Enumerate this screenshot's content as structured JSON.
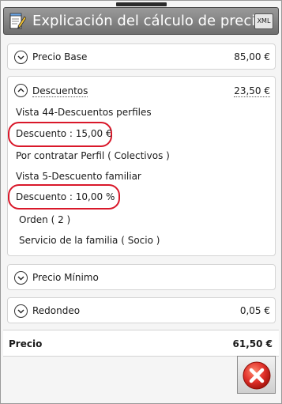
{
  "window": {
    "title": "Explicación del cálculo de precios",
    "xml_label": "XML"
  },
  "rows": {
    "precio_base": {
      "label": "Precio Base",
      "amount": "85,00 €"
    },
    "descuentos": {
      "label": "Descuentos",
      "amount": "23,50 €"
    },
    "precio_minimo": {
      "label": "Precio Mínimo"
    },
    "redondeo": {
      "label": "Redondeo",
      "amount": "0,05 €"
    }
  },
  "descuentos_detail": {
    "vista1": "Vista 44-Descuentos perfiles",
    "descuento1": "Descuento : 15,00 €",
    "contratar": "Por contratar  Perfil ( Colectivos )",
    "vista2": "Vista 5-Descuento familiar",
    "descuento2": "Descuento : 10,00 %",
    "orden": "Orden ( 2 )",
    "servicio": "Servicio de la familia ( Socio )"
  },
  "total": {
    "label": "Precio",
    "amount": "61,50 €"
  },
  "icons": {
    "app": "notepad-pencil-icon",
    "expand": "chevron-down-icon",
    "collapse": "chevron-up-icon",
    "close": "close-x-icon"
  },
  "colors": {
    "highlight": "#d9182a",
    "close": "#e0302a"
  }
}
